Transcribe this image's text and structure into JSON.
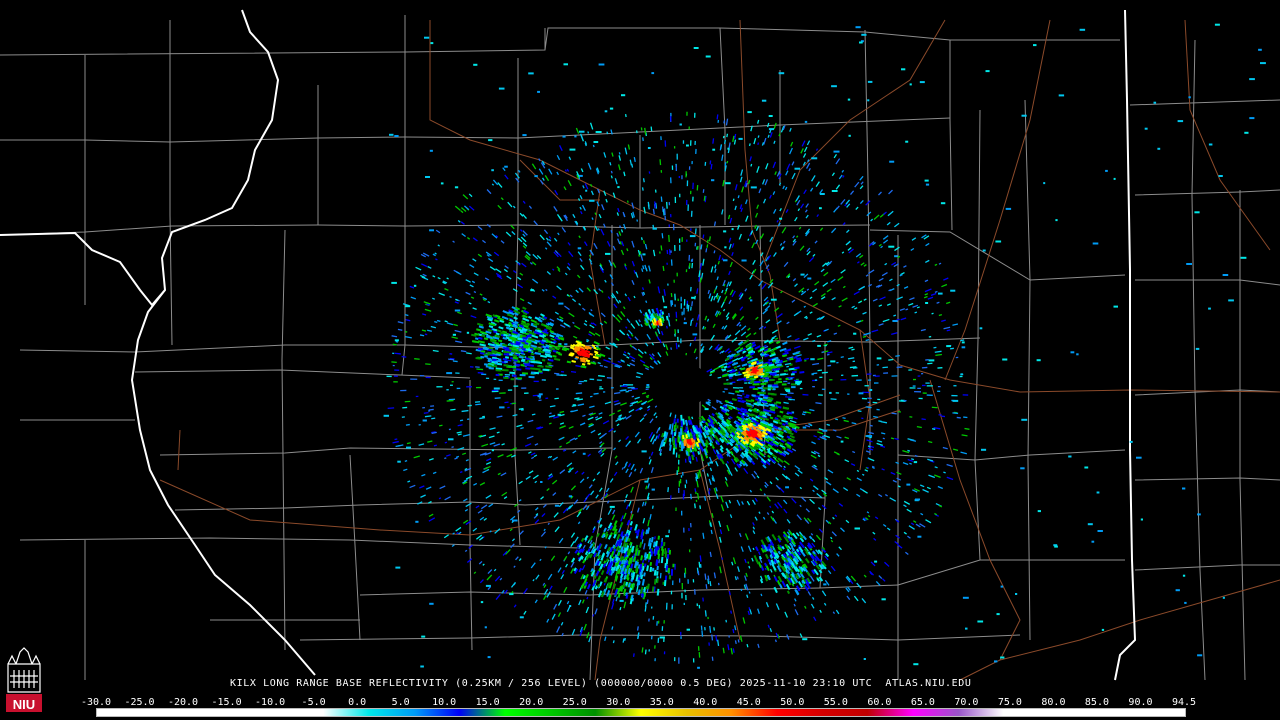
{
  "title": "KILX LONG RANGE BASE REFLECTIVITY (0.25KM / 256 LEVEL) (000000/0000 0.5 DEG) 2025-11-10 23:10 UTC  ATLAS.NIU.EDU",
  "logo": {
    "text": "NIU",
    "icon": "niu-tower-logo-icon"
  },
  "colors": {
    "background": "#000000",
    "county_lines": "#8c8c8c",
    "state_lines": "#ffffff",
    "roads": "#8b4a2a"
  },
  "scale": {
    "labels": [
      "-30.0",
      "-25.0",
      "-20.0",
      "-15.0",
      "-10.0",
      "-5.0",
      "0.0",
      "5.0",
      "10.0",
      "15.0",
      "20.0",
      "25.0",
      "30.0",
      "35.0",
      "40.0",
      "45.0",
      "50.0",
      "55.0",
      "60.0",
      "65.0",
      "70.0",
      "75.0",
      "80.0",
      "85.0",
      "90.0",
      "94.5"
    ],
    "colors": [
      "#ffffff",
      "#ffffff",
      "#ffffff",
      "#ffffff",
      "#ffffff",
      "#ffffff",
      "#00e8e8",
      "#009cf6",
      "#0000f6",
      "#00ff00",
      "#00c800",
      "#009000",
      "#ffff00",
      "#e7c000",
      "#ff9000",
      "#ff0000",
      "#d60000",
      "#c00000",
      "#ff00ff",
      "#9955c9",
      "#ffffff",
      "#ffffff",
      "#ffffff",
      "#ffffff",
      "#ffffff"
    ]
  }
}
